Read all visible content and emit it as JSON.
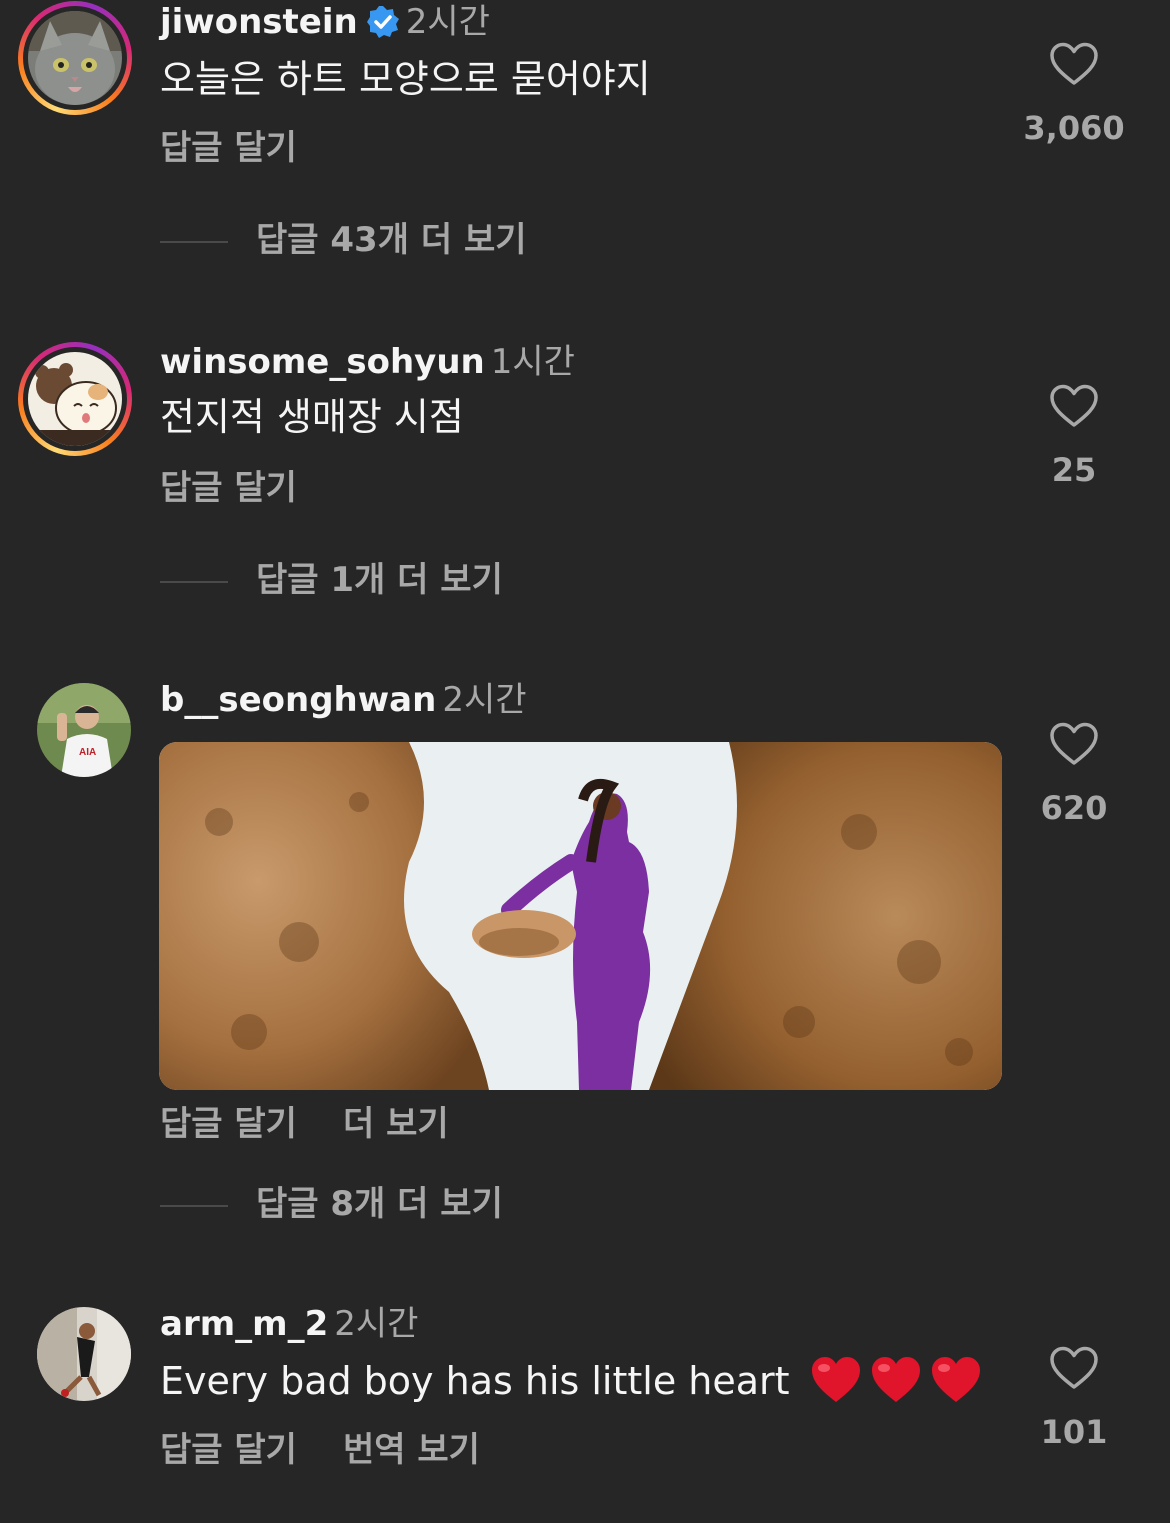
{
  "comments": [
    {
      "username": "jiwonstein",
      "verified": true,
      "time": "2시간",
      "text": "오늘은 하트 모양으로 묻어야지",
      "reply_label": "답글 달기",
      "likes": "3,060",
      "view_replies": "답글 43개 더 보기"
    },
    {
      "username": "winsome_sohyun",
      "time": "1시간",
      "text": "전지적 생매장 시점",
      "reply_label": "답글 달기",
      "likes": "25",
      "view_replies": "답글 1개 더 보기"
    },
    {
      "username": "b__seonghwan",
      "time": "2시간",
      "attachment": "gif",
      "reply_label": "답글 달기",
      "see_more_label": "더 보기",
      "likes": "620",
      "view_replies": "답글 8개 더 보기"
    },
    {
      "username": "arm_m_2",
      "time": "2시간",
      "text": "Every bad boy has his little heart",
      "emoji": [
        "heart-emoji",
        "heart-emoji",
        "heart-emoji"
      ],
      "reply_label": "답글 달기",
      "translate_label": "번역 보기",
      "likes": "101"
    }
  ],
  "colors": {
    "background": "#262626",
    "primary_text": "#f5f5f5",
    "secondary_text": "#a8a8a8",
    "verified_badge": "#3897f0",
    "heart_emoji": "#e0142a"
  }
}
